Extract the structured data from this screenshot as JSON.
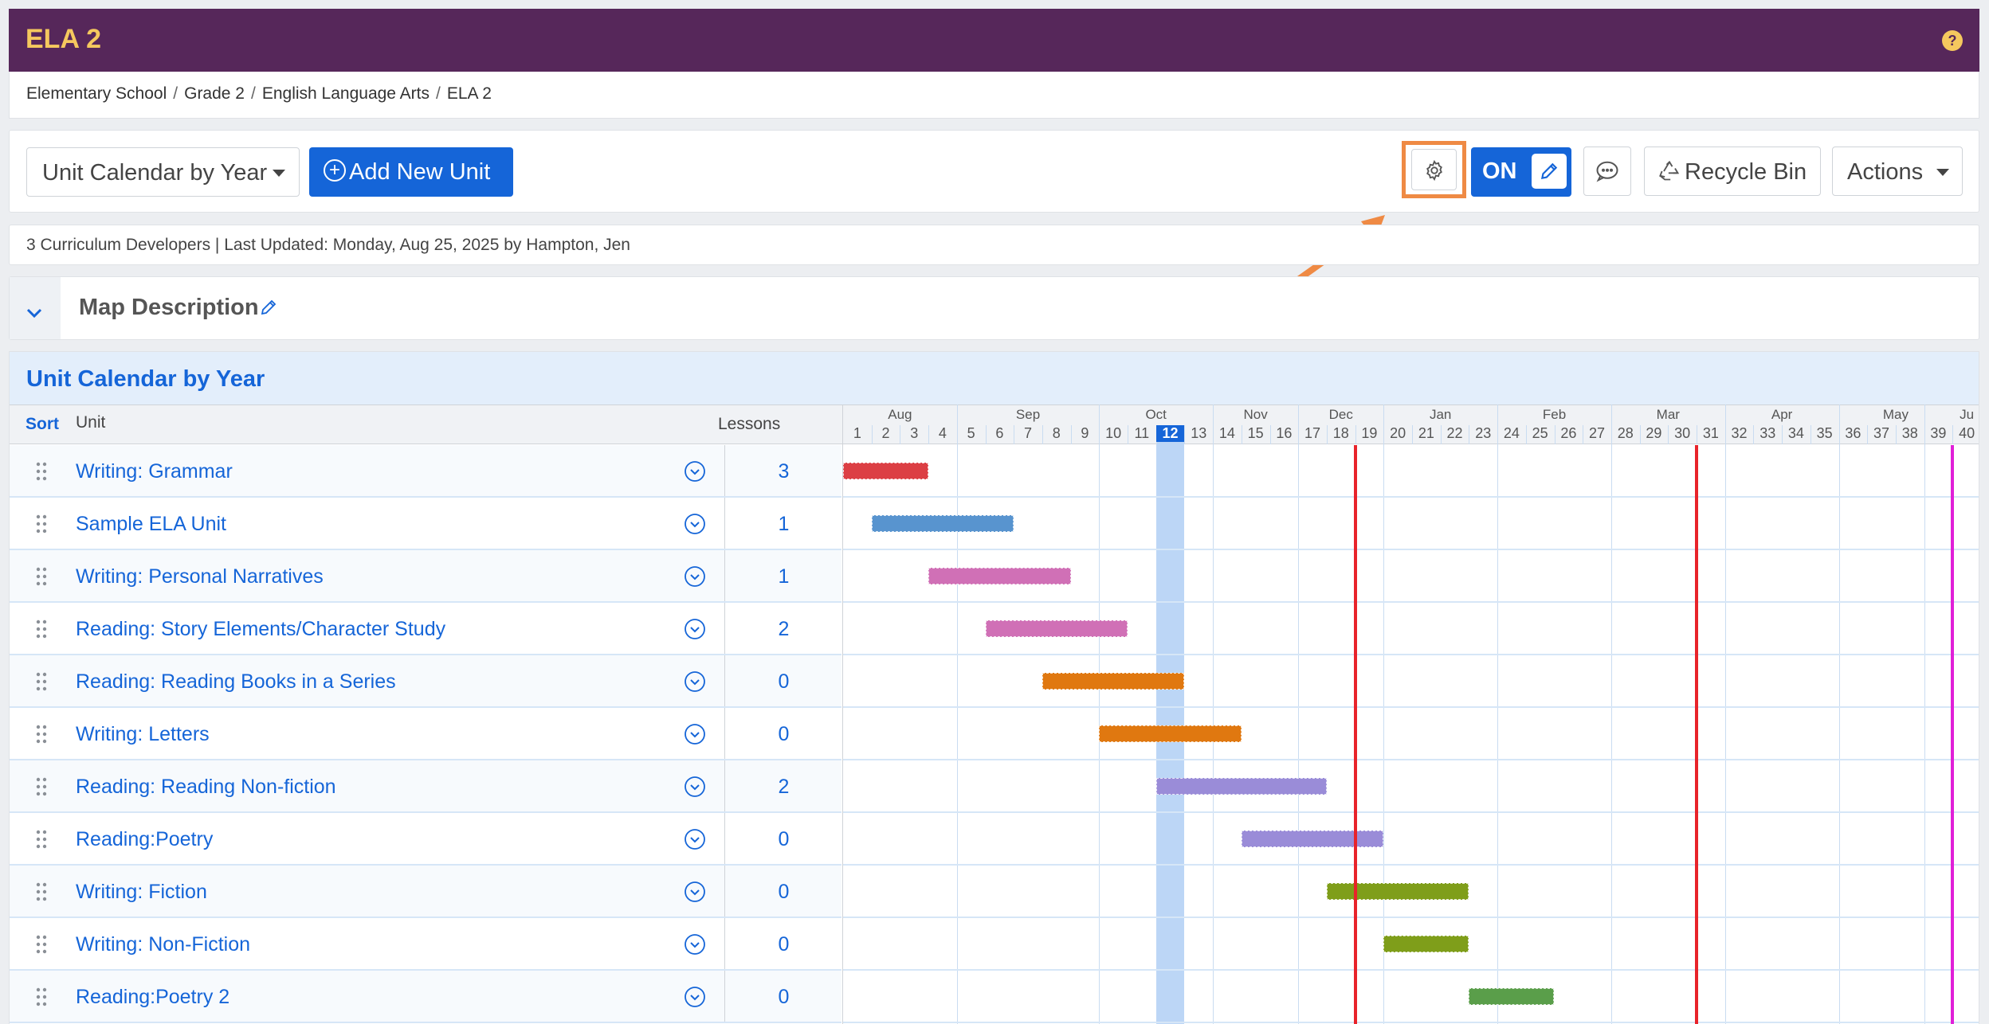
{
  "app": {
    "title": "ELA 2",
    "help_icon": "question-circle-icon"
  },
  "breadcrumb": [
    "Elementary School",
    "Grade 2",
    "English Language Arts",
    "ELA 2"
  ],
  "toolbar": {
    "view_select": "Unit Calendar by Year",
    "add_unit_label": "Add New Unit",
    "toggle_label": "ON",
    "recycle_label": "Recycle Bin",
    "actions_label": "Actions"
  },
  "meta": {
    "text": "3 Curriculum Developers | Last Updated: Monday, Aug 25, 2025 by Hampton, Jen"
  },
  "description": {
    "title": "Map Description"
  },
  "calendar": {
    "title": "Unit Calendar by Year",
    "sort_label": "Sort",
    "unit_header": "Unit",
    "lessons_header": "Lessons",
    "current_week": 12,
    "months": [
      {
        "label": "Aug",
        "week": 2.5
      },
      {
        "label": "Sep",
        "week": 7
      },
      {
        "label": "Oct",
        "week": 11.5
      },
      {
        "label": "Nov",
        "week": 15
      },
      {
        "label": "Dec",
        "week": 18
      },
      {
        "label": "Jan",
        "week": 21.5
      },
      {
        "label": "Feb",
        "week": 25.5
      },
      {
        "label": "Mar",
        "week": 29.5
      },
      {
        "label": "Apr",
        "week": 33.5
      },
      {
        "label": "May",
        "week": 37.5
      },
      {
        "label": "Ju",
        "week": 40
      }
    ],
    "month_starts": [
      5,
      10,
      14,
      17,
      20,
      24,
      28,
      32,
      36,
      39
    ],
    "weeks": [
      1,
      2,
      3,
      4,
      5,
      6,
      7,
      8,
      9,
      10,
      11,
      12,
      13,
      14,
      15,
      16,
      17,
      18,
      19,
      20,
      21,
      22,
      23,
      24,
      25,
      26,
      27,
      28,
      29,
      30,
      31,
      32,
      33,
      34,
      35,
      36,
      37,
      38,
      39,
      40
    ],
    "markers": [
      {
        "week": 18.5,
        "color": "#e8232a"
      },
      {
        "week": 30.5,
        "color": "#e8232a"
      },
      {
        "week": 39.5,
        "color": "#e020d8"
      }
    ],
    "units": [
      {
        "name": "Writing: Grammar",
        "lessons": "3",
        "start": 1,
        "end": 3,
        "color": "#dc3f44"
      },
      {
        "name": "Sample ELA Unit",
        "lessons": "1",
        "start": 2,
        "end": 6,
        "color": "#5894cf"
      },
      {
        "name": "Writing: Personal Narratives",
        "lessons": "1",
        "start": 4,
        "end": 8,
        "color": "#d070b6"
      },
      {
        "name": "Reading: Story Elements/Character Study",
        "lessons": "2",
        "start": 6,
        "end": 10,
        "color": "#d070b6"
      },
      {
        "name": "Reading: Reading Books in a Series",
        "lessons": "0",
        "start": 8,
        "end": 12,
        "color": "#e07810"
      },
      {
        "name": "Writing: Letters",
        "lessons": "0",
        "start": 10,
        "end": 14,
        "color": "#e07810"
      },
      {
        "name": "Reading: Reading Non-fiction",
        "lessons": "2",
        "start": 12,
        "end": 17,
        "color": "#9a8cd8"
      },
      {
        "name": "Reading:Poetry",
        "lessons": "0",
        "start": 15,
        "end": 19,
        "color": "#9a8cd8"
      },
      {
        "name": "Writing: Fiction",
        "lessons": "0",
        "start": 18,
        "end": 22,
        "color": "#7f9e1a"
      },
      {
        "name": "Writing: Non-Fiction",
        "lessons": "0",
        "start": 20,
        "end": 22,
        "color": "#7f9e1a"
      },
      {
        "name": "Reading:Poetry 2",
        "lessons": "0",
        "start": 23,
        "end": 25,
        "color": "#5a9e4a"
      }
    ]
  }
}
